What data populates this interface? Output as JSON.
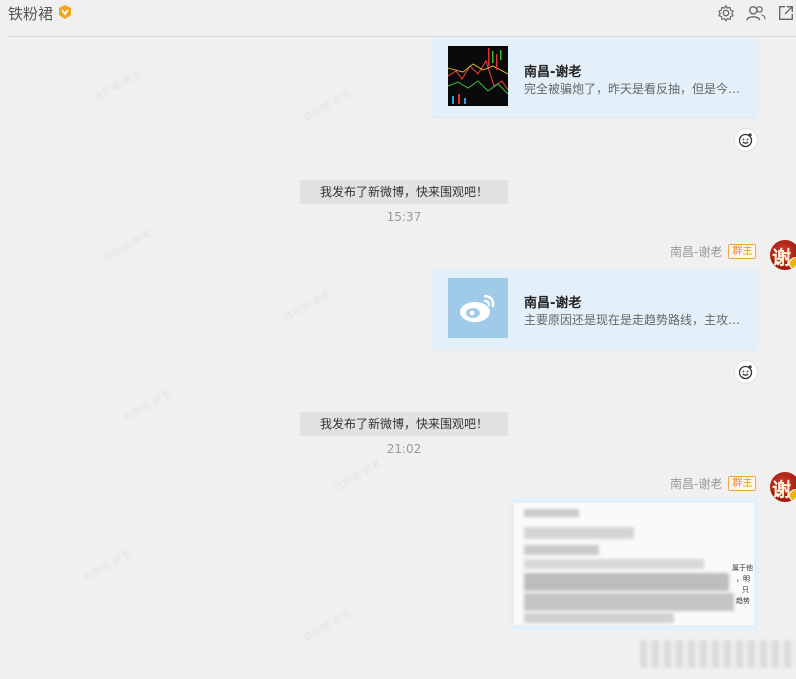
{
  "header": {
    "title": "铁粉裙",
    "icons": [
      "settings-icon",
      "members-icon",
      "popout-icon"
    ]
  },
  "messages": {
    "card1": {
      "title": "南昌-谢老",
      "desc": "完全被骗炮了，昨天是看反抽，但是今天直接暴跌"
    },
    "sys1": {
      "text": "我发布了新微博，快来围观吧！",
      "time": "15:37"
    },
    "sender2": {
      "name": "南昌-谢老",
      "tag": "群主",
      "avatar_char": "谢"
    },
    "card2": {
      "title": "南昌-谢老",
      "desc": "主要原因还是现在是走趋势路线，主攻方向没有变"
    },
    "sys2": {
      "text": "我发布了新微博，快来围观吧！",
      "time": "21:02"
    },
    "sender3": {
      "name": "南昌-谢老",
      "tag": "群主",
      "avatar_char": "谢"
    },
    "image_snippets": [
      "属于他",
      "，明",
      "只",
      "趋势"
    ]
  },
  "colors": {
    "card_bg": "#e3f0fa",
    "owner_tag": "#f08a24",
    "page_bg": "#f0f0f0"
  }
}
